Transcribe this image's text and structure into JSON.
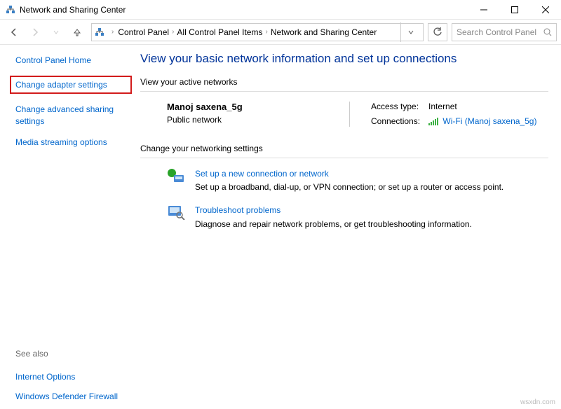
{
  "window": {
    "title": "Network and Sharing Center"
  },
  "nav": {
    "breadcrumb": [
      "Control Panel",
      "All Control Panel Items",
      "Network and Sharing Center"
    ],
    "search_placeholder": "Search Control Panel"
  },
  "sidebar": {
    "home": "Control Panel Home",
    "items": [
      "Change adapter settings",
      "Change advanced sharing settings",
      "Media streaming options"
    ],
    "see_also_label": "See also",
    "see_also": [
      "Internet Options",
      "Windows Defender Firewall"
    ]
  },
  "main": {
    "title": "View your basic network information and set up connections",
    "active_label": "View your active networks",
    "network": {
      "name": "Manoj saxena_5g",
      "type": "Public network",
      "access_label": "Access type:",
      "access_value": "Internet",
      "conn_label": "Connections:",
      "conn_value": "Wi-Fi (Manoj saxena_5g)"
    },
    "change_label": "Change your networking settings",
    "items": [
      {
        "title": "Set up a new connection or network",
        "desc": "Set up a broadband, dial-up, or VPN connection; or set up a router or access point."
      },
      {
        "title": "Troubleshoot problems",
        "desc": "Diagnose and repair network problems, or get troubleshooting information."
      }
    ]
  },
  "watermark": "wsxdn.com"
}
